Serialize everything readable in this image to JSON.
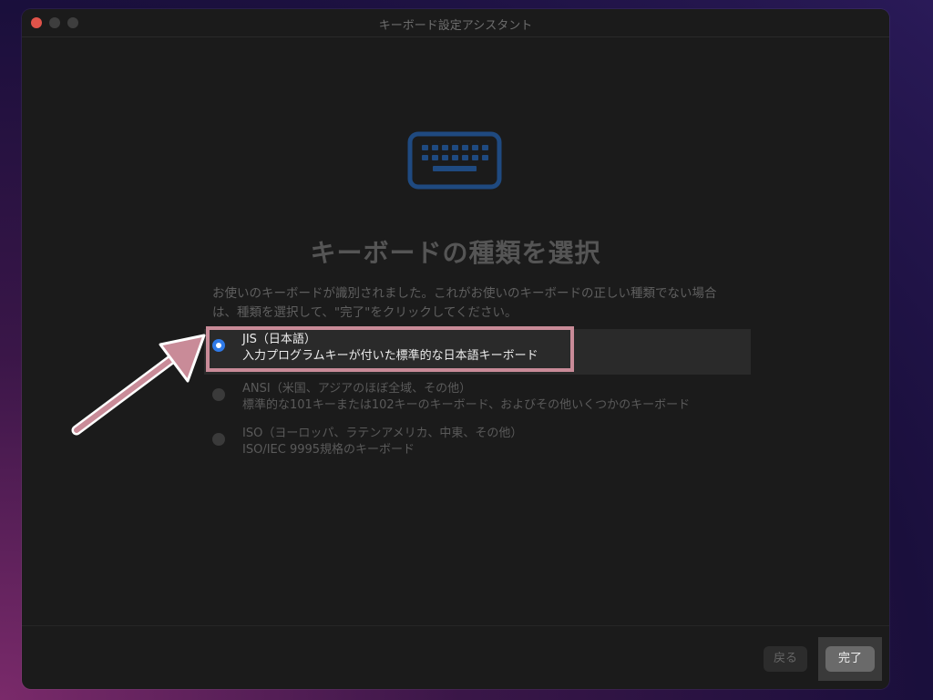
{
  "window": {
    "title": "キーボード設定アシスタント"
  },
  "main": {
    "icon": "keyboard-icon",
    "heading": "キーボードの種類を選択",
    "description": "お使いのキーボードが識別されました。これがお使いのキーボードの正しい種類でない場合は、種類を選択して、\"完了\"をクリックしてください。",
    "options": [
      {
        "title": "JIS（日本語）",
        "subtitle": "入力プログラムキーが付いた標準的な日本語キーボード",
        "selected": true
      },
      {
        "title": "ANSI（米国、アジアのほぼ全域、その他）",
        "subtitle": "標準的な101キーまたは102キーのキーボード、およびその他いくつかのキーボード",
        "selected": false
      },
      {
        "title": "ISO（ヨーロッパ、ラテンアメリカ、中東、その他）",
        "subtitle": "ISO/IEC 9995規格のキーボード",
        "selected": false
      }
    ]
  },
  "footer": {
    "back_label": "戻る",
    "done_label": "完了"
  },
  "colors": {
    "accent": "#2f7ae8",
    "icon": "#1f4a80",
    "annotation": "#c98b98"
  }
}
